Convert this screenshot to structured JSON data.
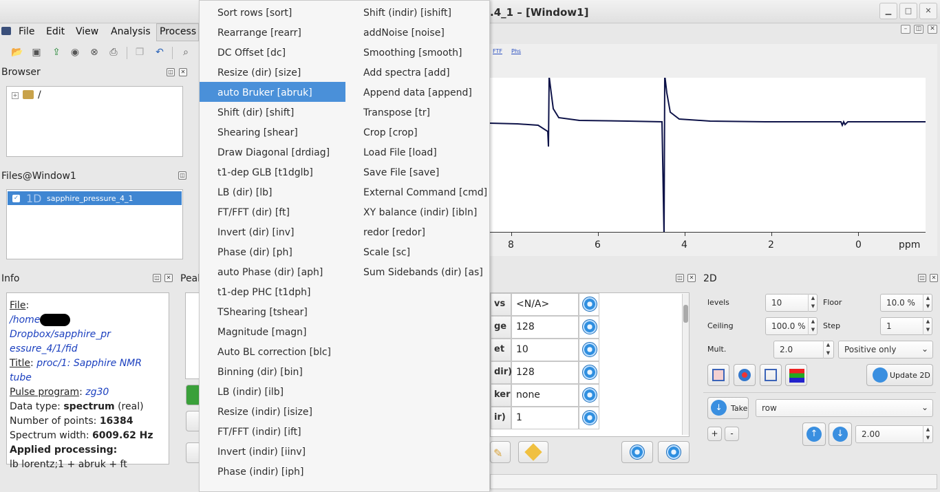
{
  "window": {
    "title": ".4_1 – [Window1]"
  },
  "menubar": {
    "items": [
      "File",
      "Edit",
      "View",
      "Analysis",
      "Process"
    ]
  },
  "browser": {
    "title": "Browser",
    "root": "/"
  },
  "files": {
    "title": "Files@Window1",
    "badge": "1D",
    "filename": "sapphire_pressure_4_1"
  },
  "info": {
    "title": "Info",
    "file_label": "File",
    "file_path_1": "/home",
    "file_path_2": "Dropbox/sapphire_pr",
    "file_path_3": "essure_4/1/fid",
    "title_label": "Title",
    "title_value": "proc/1: Sapphire NMR tube",
    "pulse_label": "Pulse program",
    "pulse_value": "zg30",
    "dtype_label": "Data type: ",
    "dtype_value": "spectrum",
    "dtype_suffix": " (real)",
    "npts_label": "Number of points: ",
    "npts_value": "16384",
    "sw_label": "Spectrum width: ",
    "sw_value": "6009.62 Hz",
    "applied_label": "Applied processing:",
    "applied_value": "lb lorentz;1 + abruk + ft"
  },
  "peaks": {
    "title": "Peal"
  },
  "plot_toolbar": {
    "ftf": "FTF",
    "phs": "Phs"
  },
  "spectrum": {
    "x_ticks": [
      "8",
      "6",
      "4",
      "2",
      "0"
    ],
    "x_unit": "ppm",
    "line_color": "#0d1248"
  },
  "context_menu": {
    "col1": [
      "Sort rows [sort]",
      "Rearrange [rearr]",
      "DC Offset [dc]",
      "Resize (dir) [size]",
      "auto Bruker [abruk]",
      "Shift (dir) [shift]",
      "Shearing [shear]",
      "Draw Diagonal [drdiag]",
      "t1-dep GLB [t1dglb]",
      "LB (dir) [lb]",
      "FT/FFT (dir) [ft]",
      "Invert (dir) [inv]",
      "Phase (dir) [ph]",
      "auto Phase (dir) [aph]",
      "t1-dep PHC [t1dph]",
      "TShearing [tshear]",
      "Magnitude [magn]",
      "Auto BL correction [blc]",
      "Binning (dir) [bin]",
      "LB (indir) [ilb]",
      "Resize (indir) [isize]",
      "FT/FFT (indir) [ift]",
      "Invert (indir) [iinv]",
      "Phase (indir) [iph]"
    ],
    "col2": [
      "Shift (indir) [ishift]",
      "addNoise [noise]",
      "Smoothing [smooth]",
      "Add spectra [add]",
      "Append data [append]",
      "Transpose [tr]",
      "Crop [crop]",
      "Load File [load]",
      "Save File [save]",
      "External Command [cmd]",
      "XY balance (indir) [ibln]",
      "redor [redor]",
      "Scale [sc]",
      "Sum Sidebands (dir) [as]"
    ],
    "selected": "auto Bruker [abruk]"
  },
  "params": {
    "rows": [
      {
        "key": "vs",
        "value": "<N/A>"
      },
      {
        "key": "ge",
        "value": "128"
      },
      {
        "key": "et",
        "value": "10"
      },
      {
        "key": "dir)",
        "value": "128"
      },
      {
        "key": "ker",
        "value": "none"
      },
      {
        "key": "ir)",
        "value": "1"
      }
    ]
  },
  "twod": {
    "title": "2D",
    "levels_label": "levels",
    "levels_value": "10",
    "floor_label": "Floor",
    "floor_value": "10.0 %",
    "ceiling_label": "Ceiling",
    "ceiling_value": "100.0 %",
    "step_label": "Step",
    "step_value": "1",
    "mult_label": "Mult.",
    "mult_value": "2.0",
    "sign_option": "Positive only",
    "update_label": "Update 2D",
    "take_label": "Take",
    "take_option": "row",
    "plus": "+",
    "minus": "-",
    "slice_value": "2.00"
  }
}
